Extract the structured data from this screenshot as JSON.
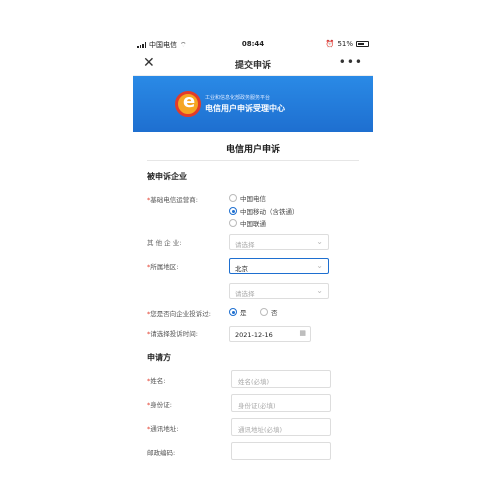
{
  "status_bar": {
    "carrier": "中国电信",
    "time": "08:44",
    "battery": "51%"
  },
  "nav": {
    "title": "提交申诉",
    "close": "✕",
    "more": "•••"
  },
  "banner": {
    "org": "工业和信息化部政务服务平台",
    "center": "电信用户申诉受理中心"
  },
  "form": {
    "title": "电信用户申诉",
    "section_respondent": "被申诉企业",
    "operator_label": "基础电信运营商:",
    "operators": [
      "中国电信",
      "中国移动（含铁通）",
      "中国联通"
    ],
    "operator_selected": "中国移动（含铁通）",
    "other_company_label": "其 他 企 业:",
    "other_company_placeholder": "请选择",
    "region_label": "所属地区:",
    "region_value": "北京",
    "region_sub_placeholder": "请选择",
    "complained_label": "您是否向企业投诉过:",
    "complained_yes": "是",
    "complained_no": "否",
    "complained_selected": "是",
    "date_label": "请选择投诉时间:",
    "date_value": "2021-12-16",
    "section_applicant": "申请方",
    "name_label": "姓名:",
    "name_placeholder": "姓名(必填)",
    "id_label": "身份证:",
    "id_placeholder": "身份证(必填)",
    "address_label": "通讯地址:",
    "address_placeholder": "通讯地址(必填)",
    "postal_label": "邮政编码:",
    "postal_placeholder": ""
  },
  "colors": {
    "accent": "#1e6fd0",
    "required": "#e23b2a",
    "banner": "#2a8ae6"
  }
}
